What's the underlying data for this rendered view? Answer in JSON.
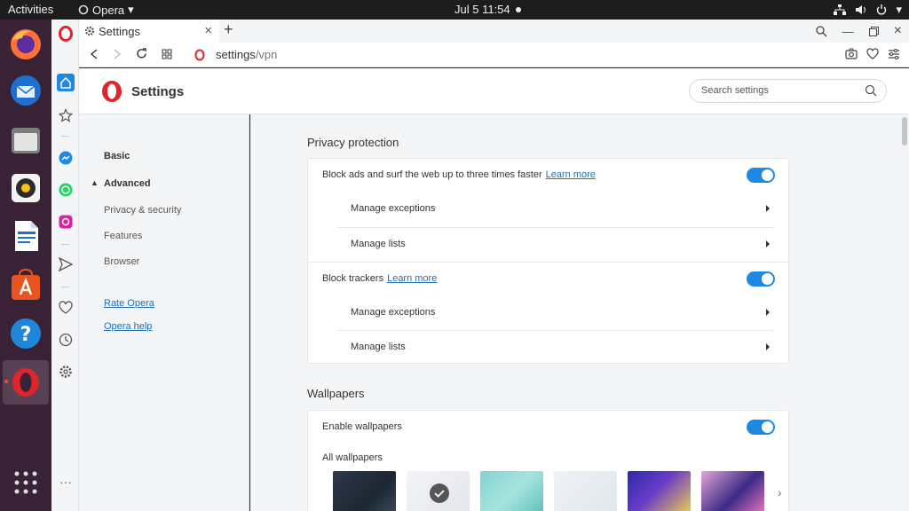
{
  "topbar": {
    "activities": "Activities",
    "app": "Opera",
    "clock": "Jul 5  11:54"
  },
  "tab": {
    "title": "Settings"
  },
  "address": {
    "host": "settings",
    "path": "/vpn"
  },
  "header": {
    "title": "Settings",
    "search_placeholder": "Search settings"
  },
  "nav": {
    "basic": "Basic",
    "advanced": "Advanced",
    "privacy": "Privacy & security",
    "features": "Features",
    "browser": "Browser",
    "rate": "Rate Opera",
    "help": "Opera help"
  },
  "privacy": {
    "title": "Privacy protection",
    "block_ads": "Block ads and surf the web up to three times faster",
    "block_ads_learn": "Learn more",
    "block_ads_on": true,
    "ads_exceptions": "Manage exceptions",
    "ads_lists": "Manage lists",
    "block_trackers": "Block trackers",
    "trackers_learn": "Learn more",
    "trackers_on": true,
    "trackers_exceptions": "Manage exceptions",
    "trackers_lists": "Manage lists"
  },
  "wallpapers": {
    "title": "Wallpapers",
    "enable": "Enable wallpapers",
    "enable_on": true,
    "all": "All wallpapers"
  },
  "colors": {
    "accent": "#1e88e5",
    "opera_red": "#e0242c",
    "link": "#1e6fb5",
    "dock": "#3a2236"
  }
}
